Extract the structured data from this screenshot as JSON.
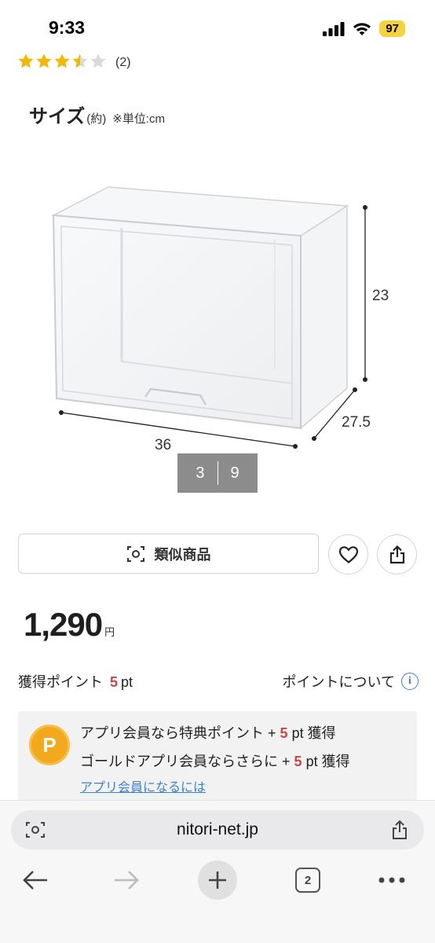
{
  "status": {
    "time": "9:33",
    "battery": "97"
  },
  "rating": {
    "stars": 3.5,
    "max": 5,
    "count": "(2)"
  },
  "size_section": {
    "title": "サイズ",
    "approx": "(約)",
    "unit_note": "※単位:cm"
  },
  "dimensions": {
    "width": "36",
    "depth": "27.5",
    "height": "23"
  },
  "image_counter": {
    "current": "3",
    "total": "9"
  },
  "actions": {
    "similar_label": "類似商品",
    "similar_icon": "camera-scan-icon",
    "favorite_icon": "heart-icon",
    "share_icon": "share-icon"
  },
  "price": {
    "value": "1,290",
    "unit": "円"
  },
  "points": {
    "label": "獲得ポイント",
    "value": "5",
    "unit": "pt",
    "about_label": "ポイントについて",
    "info_glyph": "i"
  },
  "member_box": {
    "badge": "P",
    "line1_prefix": "アプリ会員なら特典ポイント +",
    "line1_value": "5",
    "line1_suffix": "pt 獲得",
    "line2_prefix": "ゴールドアプリ会員ならさらに +",
    "line2_value": "5",
    "line2_suffix": "pt 獲得",
    "link": "アプリ会員になるには"
  },
  "browser": {
    "url": "nitori-net.jp",
    "tab_count": "2"
  },
  "colors": {
    "star": "#f5b800",
    "star_empty": "#d9d9d9",
    "accent_red": "#c44444",
    "link_blue": "#3b82d6",
    "badge_orange": "#f2a91b"
  }
}
